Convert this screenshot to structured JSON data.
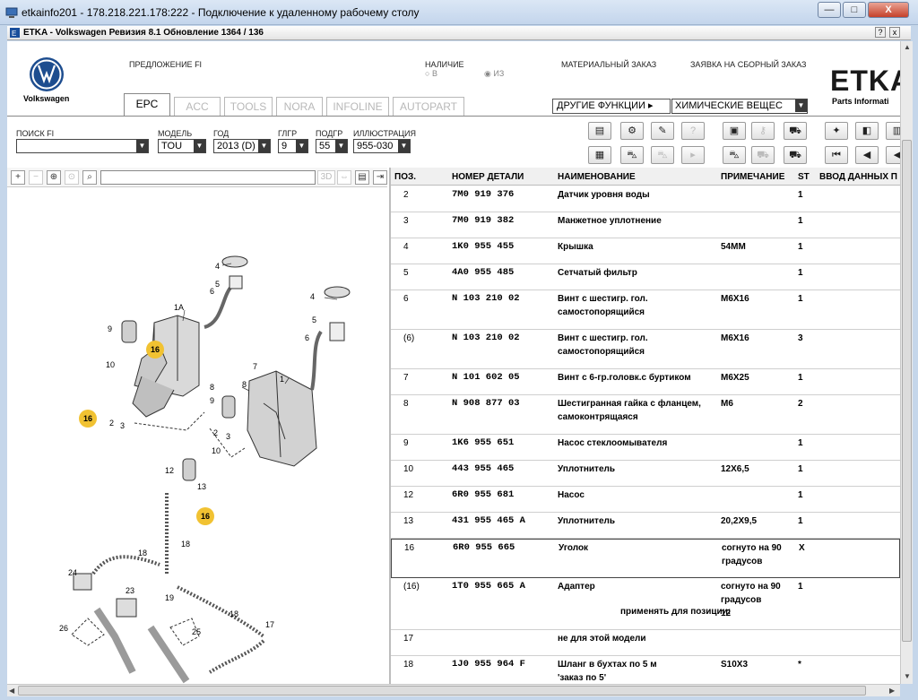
{
  "rdp": {
    "title": "etkainfo201 - 178.218.221.178:222 - Подключение к удаленному рабочему столу",
    "min_label": "—",
    "max_label": "□",
    "close_label": "X"
  },
  "etka": {
    "title": "ETKA - Volkswagen Ревизия 8.1 Обновление 1364 / 136",
    "help_label": "?",
    "close_label": "x"
  },
  "header": {
    "brand": "Volkswagen",
    "offer_fi": "ПРЕДЛОЖЕНИЕ FI",
    "availability": "НАЛИЧИЕ",
    "radio_v": "В",
    "radio_iz": "ИЗ",
    "material_order": "МАТЕРИАЛЬНЫЙ ЗАКАЗ",
    "assembly_order": "ЗАЯВКА НА СБОРНЫЙ ЗАКАЗ",
    "etka_logo": "ETKA",
    "etka_sub": "Parts Informati"
  },
  "tabs": [
    {
      "label": "EPC"
    },
    {
      "label": "ACC"
    },
    {
      "label": "TOOLS"
    },
    {
      "label": "NORA"
    },
    {
      "label": "INFOLINE"
    },
    {
      "label": "AUTOPART"
    }
  ],
  "other_functions": {
    "label": "ДРУГИЕ ФУНКЦИИ",
    "value": "ХИМИЧЕСКИЕ ВЕЩЕС"
  },
  "filters": {
    "search_fi": {
      "label": "ПОИСК FI",
      "value": ""
    },
    "model": {
      "label": "МОДЕЛЬ",
      "value": "TOU"
    },
    "year": {
      "label": "ГОД",
      "value": "2013 (D)"
    },
    "main_group": {
      "label": "ГЛГР",
      "value": "9"
    },
    "sub_group": {
      "label": "ПОДГР",
      "value": "55"
    },
    "illustration": {
      "label": "ИЛЛЮСТРАЦИЯ",
      "value": "955-030"
    }
  },
  "illustration_toolbar": {
    "btn_3d": "3D"
  },
  "table": {
    "headers": {
      "pos": "ПОЗ.",
      "part": "НОМЕР ДЕТАЛИ",
      "name": "НАИМЕНОВАНИЕ",
      "note": "ПРИМЕЧАНИЕ",
      "st": "ST",
      "input": "ВВОД ДАННЫХ П"
    },
    "rows": [
      {
        "pos": "2",
        "part": "7M0 919 376",
        "name": "Датчик уровня воды",
        "note": "",
        "st": "1"
      },
      {
        "pos": "3",
        "part": "7M0 919 382",
        "name": "Манжетное уплотнение",
        "note": "",
        "st": "1"
      },
      {
        "pos": "4",
        "part": "1K0 955 455",
        "name": "Крышка",
        "note": "54MM",
        "st": "1"
      },
      {
        "pos": "5",
        "part": "4A0 955 485",
        "name": "Сетчатый фильтр",
        "note": "",
        "st": "1"
      },
      {
        "pos": "6",
        "part": "N   103 210 02",
        "name": "Винт с шестигр. гол.",
        "name2": "самостопорящийся",
        "note": "M6X16",
        "st": "1"
      },
      {
        "pos": "(6)",
        "part": "N   103 210 02",
        "name": "Винт с шестигр. гол.",
        "name2": "самостопорящийся",
        "note": "M6X16",
        "st": "3"
      },
      {
        "pos": "7",
        "part": "N   101 602 05",
        "name": "Винт с 6-гр.головк.с буртиком",
        "note": "M6X25",
        "st": "1"
      },
      {
        "pos": "8",
        "part": "N   908 877 03",
        "name": "Шестигранная гайка с фланцем,",
        "name2": "самоконтрящаяся",
        "note": "M6",
        "st": "2"
      },
      {
        "pos": "9",
        "part": "1K6 955 651",
        "name": "Насос стеклоомывателя",
        "note": "",
        "st": "1"
      },
      {
        "pos": "10",
        "part": "443 955 465",
        "name": "Уплотнитель",
        "note": "12X6,5",
        "st": "1"
      },
      {
        "pos": "12",
        "part": "6R0 955 681",
        "name": "Насос",
        "note": "",
        "st": "1"
      },
      {
        "pos": "13",
        "part": "431 955 465 A",
        "name": "Уплотнитель",
        "note": "20,2X9,5",
        "st": "1"
      },
      {
        "pos": "16",
        "part": "6R0 955 665",
        "name": "Уголок",
        "note": "согнуто на 90",
        "note2": "градусов",
        "st": "X"
      },
      {
        "pos": "(16)",
        "part": "1T0 955 665 A",
        "name": "Адаптер",
        "note": "согнуто на 90",
        "note2": "градусов",
        "note3": "12",
        "sub": "применять для позиции:",
        "st": "1"
      },
      {
        "pos": "17",
        "part": "",
        "name": "не для этой модели",
        "note": "",
        "st": ""
      },
      {
        "pos": "18",
        "part": "1J0 955 964 F",
        "name": "Шланг в бухтах по 5 м",
        "name2": "'заказ по 5'",
        "note": "S10X3",
        "st": "*"
      }
    ]
  },
  "diagram_labels": {
    "l1A": "1A",
    "l1": "1",
    "l2": "2",
    "l2b": "2",
    "l3": "3",
    "l3b": "3",
    "l4": "4",
    "l4b": "4",
    "l5": "5",
    "l5b": "5",
    "l6": "6",
    "l6b": "6",
    "l7": "7",
    "l8": "8",
    "l8b": "8",
    "l9": "9",
    "l9b": "9",
    "l10": "10",
    "l10b": "10",
    "l12": "12",
    "l13": "13",
    "l16a": "16",
    "l16b": "16",
    "l16c": "16",
    "l17": "17",
    "l18a": "18",
    "l18b": "18",
    "l18c": "18",
    "l19": "19",
    "l23": "23",
    "l24": "24",
    "l25": "25",
    "l26": "26"
  }
}
